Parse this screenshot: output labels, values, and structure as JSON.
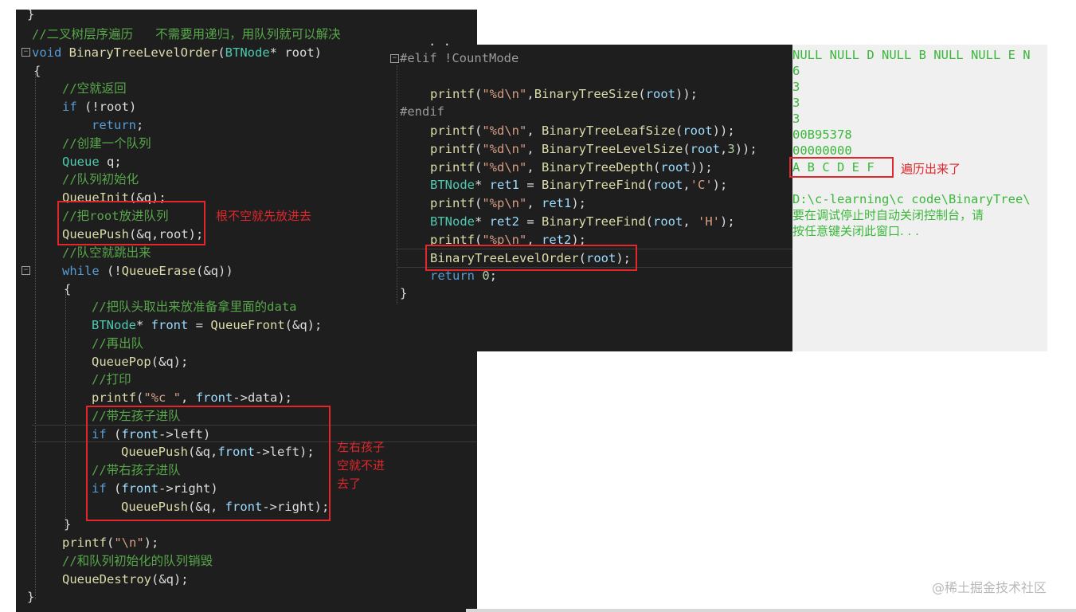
{
  "left_code": {
    "top_brace": "}",
    "comment_title": "//二叉树层序遍历   不需要用递归，用队列就可以解决",
    "sig_kw": "void",
    "sig_fn": "BinaryTreeLevelOrder",
    "sig_open": "(",
    "sig_type": "BTNode",
    "sig_rest": "* root)",
    "open_brace": "{",
    "c_empty_return": "//空就返回",
    "if_kw": "if",
    "if_cond": " (!root)",
    "return_kw": "return",
    "semicolon": ";",
    "c_create_queue": "//创建一个队列",
    "queue_type": "Queue",
    "queue_var": " q;",
    "c_queue_init": "//队列初始化",
    "queue_init_fn": "QueueInit",
    "queue_init_args": "(&q);",
    "c_push_root": "//把root放进队列",
    "push_fn": "QueuePush",
    "push_root_args": "(&q,root);",
    "c_queue_empty": "//队空就跳出来",
    "while_kw": "while",
    "while_open": " (!",
    "erase_fn": "QueueErase",
    "while_close": "(&q))",
    "inner_open": "{",
    "c_take_front": "//把队头取出来放准备拿里面的data",
    "front_type": "BTNode",
    "front_star": "* ",
    "front_var": "front",
    "front_eq": " = ",
    "front_fn": "QueueFront",
    "front_args": "(&q);",
    "c_pop": "//再出队",
    "pop_fn": "QueuePop",
    "pop_args": "(&q);",
    "c_print": "//打印",
    "printf_fn": "printf",
    "printf_open": "(",
    "printf_fmt": "\"%c \"",
    "printf_sep": ", ",
    "printf_front": "front",
    "printf_data": "->data);",
    "c_left_child": "//带左孩子进队",
    "if_left_kw": "if",
    "if_left_open": " (",
    "if_left_front": "front",
    "if_left_rest": "->left)",
    "push_left_fn": "QueuePush",
    "push_left_open": "(&q,",
    "push_left_front": "front",
    "push_left_rest": "->left);",
    "c_right_child": "//带右孩子进队",
    "if_right_kw": "if",
    "if_right_open": " (",
    "if_right_front": "front",
    "if_right_rest": "->right)",
    "push_right_fn": "QueuePush",
    "push_right_open": "(&q, ",
    "push_right_front": "front",
    "push_right_rest": "->right);",
    "inner_close": "}",
    "printf_nl_fn": "printf",
    "printf_nl_open": "(",
    "printf_nl_fmt": "\"\\n\"",
    "printf_nl_close": ");",
    "c_destroy": "//和队列初始化的队列销毁",
    "destroy_fn": "QueueDestroy",
    "destroy_args": "(&q);",
    "close_brace": "}"
  },
  "mid_code": {
    "top_partial": ". .",
    "elif": "#elif !CountMode",
    "size_fn": "printf",
    "size_args_a": "(",
    "size_fmt": "\"%d\\n\"",
    "size_args_b": ",",
    "size_call": "BinaryTreeSize",
    "size_args_c": "(",
    "size_root": "root",
    "size_args_d": "));",
    "endif": "#endif",
    "leaf_fn": "printf",
    "leaf_a": "(",
    "leaf_fmt": "\"%d\\n\"",
    "leaf_b": ", ",
    "leaf_call": "BinaryTreeLeafSize",
    "leaf_c": "(",
    "leaf_root": "root",
    "leaf_d": "));",
    "level_fn": "printf",
    "level_a": "(",
    "level_fmt": "\"%d\\n\"",
    "level_b": ", ",
    "level_call": "BinaryTreeLevelSize",
    "level_c": "(",
    "level_root": "root",
    "level_d": ",",
    "level_num": "3",
    "level_e": "));",
    "depth_fn": "printf",
    "depth_a": "(",
    "depth_fmt": "\"%d\\n\"",
    "depth_b": ", ",
    "depth_call": "BinaryTreeDepth",
    "depth_c": "(",
    "depth_root": "root",
    "depth_d": "));",
    "ret1_type": "BTNode",
    "ret1_star": "* ",
    "ret1_var": "ret1",
    "ret1_eq": " = ",
    "ret1_call": "BinaryTreeFind",
    "ret1_a": "(",
    "ret1_root": "root",
    "ret1_b": ",",
    "ret1_chr": "'C'",
    "ret1_c": ");",
    "p1_fn": "printf",
    "p1_a": "(",
    "p1_fmt": "\"%p\\n\"",
    "p1_b": ", ",
    "p1_var": "ret1",
    "p1_c": ");",
    "ret2_type": "BTNode",
    "ret2_star": "* ",
    "ret2_var": "ret2",
    "ret2_eq": " = ",
    "ret2_call": "BinaryTreeFind",
    "ret2_a": "(",
    "ret2_root": "root",
    "ret2_b": ", ",
    "ret2_chr": "'H'",
    "ret2_c": ");",
    "p2_fn": "printf",
    "p2_a": "(",
    "p2_fmt": "\"%p\\n\"",
    "p2_b": ", ",
    "p2_var": "ret2",
    "p2_c": ");",
    "lo_call": "BinaryTreeLevelOrder",
    "lo_a": "(",
    "lo_root": "root",
    "lo_b": ");",
    "return_kw": "return",
    "return_num": " 0",
    "return_semi": ";",
    "close_brace": "}"
  },
  "console": {
    "lines": [
      "NULL NULL D NULL B NULL NULL E N",
      "6",
      "3",
      "3",
      "3",
      "00B95378",
      "00000000",
      "A B C D E F "
    ],
    "path_line": "D:\\c-learning\\c code\\BinaryTree\\",
    "msg_line1": "要在调试停止时自动关闭控制台，请",
    "msg_line2": "按任意键关闭此窗口. . ."
  },
  "annotations": {
    "root_push_note": "根不空就先放进去",
    "children_note_1": "左右孩子",
    "children_note_2": "空就不进",
    "children_note_3": "去了",
    "traverse_note": "遍历出来了"
  },
  "watermark": "@稀土掘金技术社区",
  "colors": {
    "editor_bg": "#1e1e1e",
    "console_bg": "#f0f0f0",
    "console_text": "#3ab83a",
    "annotation_red": "#e0272c"
  }
}
